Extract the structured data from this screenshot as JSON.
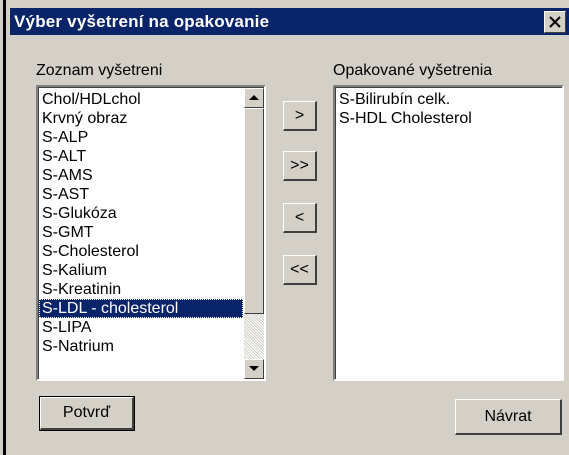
{
  "window": {
    "title": "Výber vyšetrení na opakovanie"
  },
  "left_panel": {
    "label": "Zoznam vyšetreni",
    "items": [
      "Chol/HDLchol",
      "Krvný obraz",
      "S-ALP",
      "S-ALT",
      "S-AMS",
      "S-AST",
      "S-Glukóza",
      "S-GMT",
      "S-Cholesterol",
      "S-Kalium",
      "S-Kreatinin",
      "S-LDL - cholesterol",
      "S-LIPA",
      "S-Natrium"
    ],
    "selected_index": 11
  },
  "right_panel": {
    "label": "Opakované vyšetrenia",
    "items": [
      "S-Bilirubín celk.",
      "S-HDL Cholesterol"
    ]
  },
  "transfer_buttons": {
    "add_one": ">",
    "add_all": ">>",
    "remove_one": "<",
    "remove_all": "<<"
  },
  "footer": {
    "confirm_label": "Potvrď",
    "back_label": "Návrat"
  },
  "colors": {
    "titlebar": "#0a246a",
    "selection": "#0a246a",
    "face": "#d4d0c8"
  },
  "icons": {
    "close": "close-icon",
    "scroll_up": "arrow-up-icon",
    "scroll_down": "arrow-down-icon"
  }
}
